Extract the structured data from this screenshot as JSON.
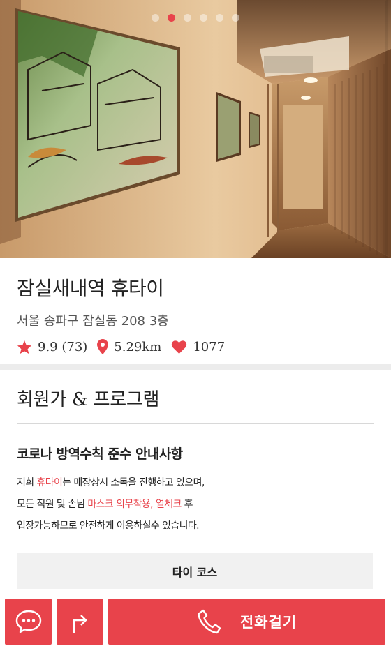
{
  "carousel": {
    "total": 6,
    "active_index": 1
  },
  "shop": {
    "title": "잠실새내역 휴타이",
    "address": "서울 송파구 잠실동 208 3층",
    "rating": "9.9 (73)",
    "distance": "5.29km",
    "likes": "1077"
  },
  "program": {
    "title_a": "회원가 ",
    "title_amp": "&",
    "title_b": " 프로그램",
    "notice_title": "코로나 방역수칙 준수 안내사항",
    "line1_a": "저희 ",
    "line1_red": "휴타이",
    "line1_b": "는 매장상시 소독을 진행하고 있으며,",
    "line2_a": "모든 직원 및 손님 ",
    "line2_red": "마스크 의무착용, 열체크",
    "line2_b": " 후",
    "line3": "입장가능하므로 안전하게 이용하실수 있습니다.",
    "course_label": "타이 코스"
  },
  "actions": {
    "chat_icon": "chat-bubble-icon",
    "share_icon": "share-arrow-icon",
    "call_icon": "phone-icon",
    "call_label": "전화걸기"
  },
  "colors": {
    "accent": "#e8434b",
    "divider": "#ececec",
    "course_bg": "#f1f1f1"
  }
}
